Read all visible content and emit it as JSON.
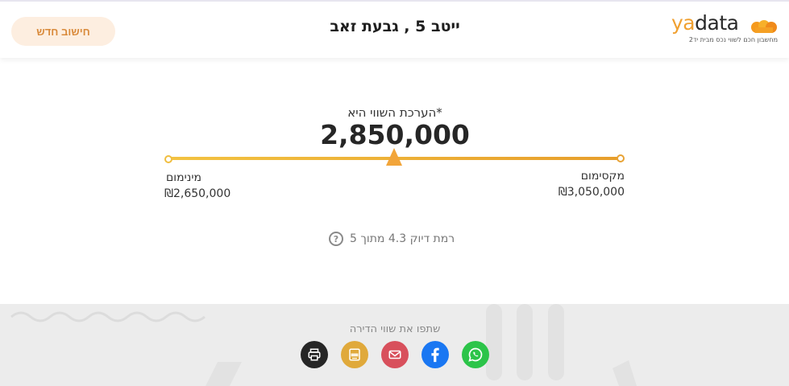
{
  "header": {
    "new_calc_label": "חישוב חדש",
    "address": "ייטב 5 , גבעת זאב",
    "logo": {
      "word_ya": "ya",
      "word_data": "data",
      "tagline": "מחשבון חכם לשווי נכס מבית יד2"
    }
  },
  "valuation": {
    "title": "*הערכת השווי היא",
    "value": "2,850,000",
    "range_position": 0.5,
    "min_label": "מינימום",
    "min_value": "₪2,650,000",
    "max_label": "מקסימום",
    "max_value": "₪3,050,000"
  },
  "accuracy": {
    "text": "רמת דיוק 4.3 מתוך 5",
    "help_glyph": "?"
  },
  "share": {
    "title": "שתפו את שווי הדירה",
    "buttons": [
      {
        "icon": "print-icon",
        "color": "#262626"
      },
      {
        "icon": "pdf-icon",
        "color": "#e0a93b"
      },
      {
        "icon": "mail-icon",
        "color": "#d8505c"
      },
      {
        "icon": "facebook-icon",
        "color": "#1a77f2"
      },
      {
        "icon": "whatsapp-icon",
        "color": "#2cc449"
      }
    ]
  },
  "colors": {
    "accent": "#f2a53a",
    "button_bg": "#fdeee0",
    "footer_bg": "#ececec"
  }
}
